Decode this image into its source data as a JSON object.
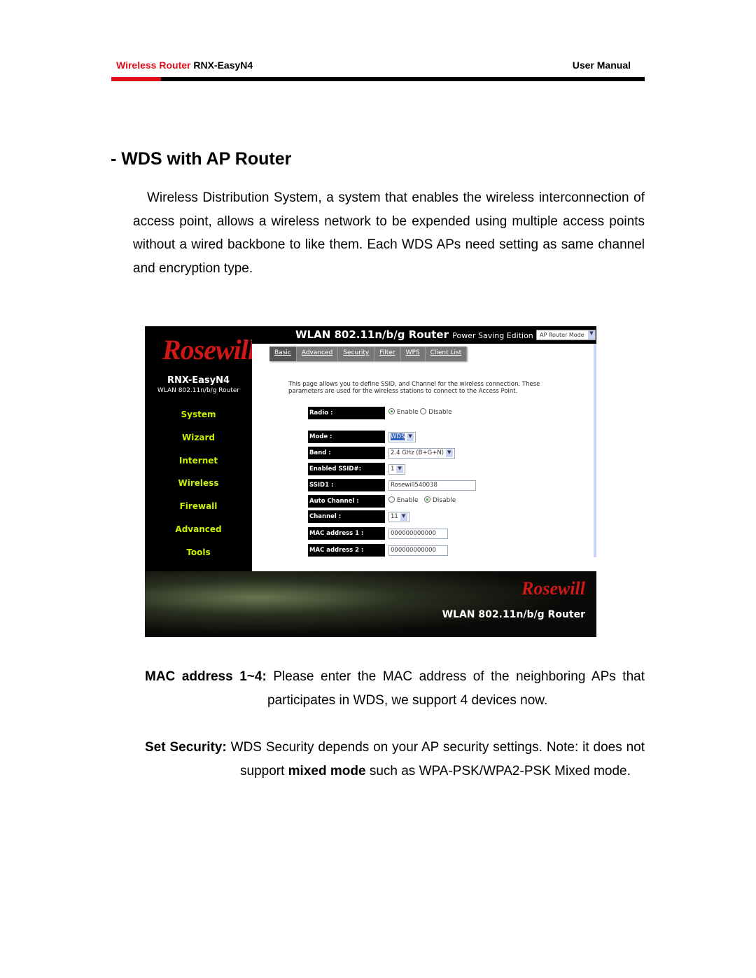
{
  "header": {
    "product_prefix": "Wireless Router",
    "model": "RNX-EasyN4",
    "doc": "User Manual"
  },
  "title": "- WDS with AP Router",
  "intro": "Wireless Distribution System, a system that enables the wireless interconnection of access point, allows a wireless network to be expended using multiple access points without a wired backbone to like them. Each WDS APs need setting as same channel and encryption type.",
  "router": {
    "logo": "Rosewill",
    "model": "RNX-EasyN4",
    "model_sub": "WLAN 802.11n/b/g Router",
    "title": "WLAN 802.11n/b/g Router",
    "title_sub": "Power Saving Edition",
    "mode_select": "AP Router Mode",
    "menu": [
      "System",
      "Wizard",
      "Internet",
      "Wireless",
      "Firewall",
      "Advanced",
      "Tools"
    ],
    "tabs": [
      "Basic",
      "Advanced",
      "Security",
      "Filter",
      "WPS",
      "Client List"
    ],
    "description": "This page allows you to define SSID, and Channel for the wireless connection. These parameters are used for the wireless stations to connect to the Access Point.",
    "fields": {
      "radio": {
        "label": "Radio :",
        "enable": "Enable",
        "disable": "Disable",
        "selected": "Enable"
      },
      "mode": {
        "label": "Mode :",
        "value": "WDS"
      },
      "band": {
        "label": "Band :",
        "value": "2.4 GHz (B+G+N)"
      },
      "enabled_ssid": {
        "label": "Enabled SSID#:",
        "value": "1"
      },
      "ssid1": {
        "label": "SSID1 :",
        "value": "Rosewill540038"
      },
      "auto_channel": {
        "label": "Auto Channel :",
        "enable": "Enable",
        "disable": "Disable",
        "selected": "Disable"
      },
      "channel": {
        "label": "Channel :",
        "value": "11"
      },
      "mac1": {
        "label": "MAC address 1 :",
        "value": "000000000000"
      },
      "mac2": {
        "label": "MAC address 2 :",
        "value": "000000000000"
      }
    },
    "banner_logo": "Rosewill",
    "banner_text": "WLAN 802.11n/b/g Router"
  },
  "definitions": [
    {
      "term": "MAC address 1~4:",
      "text": "Please enter the MAC address of the neighboring APs that participates in WDS, we support 4 devices now."
    },
    {
      "term": "Set Security:",
      "text_before": "WDS Security depends on your AP security settings. Note: it does not support",
      "bold": "mixed mode",
      "text_after": "such as WPA-PSK/WPA2-PSK Mixed mode."
    }
  ]
}
